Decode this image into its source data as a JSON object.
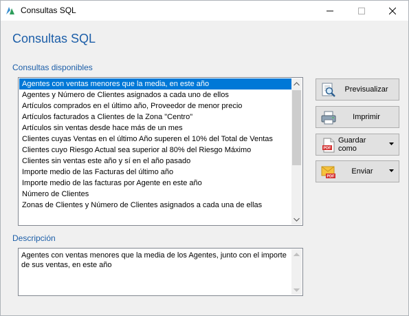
{
  "window": {
    "title": "Consultas SQL"
  },
  "heading": "Consultas SQL",
  "available": {
    "label": "Consultas disponibles",
    "selected_index": 0,
    "items": [
      "Agentes con ventas menores que la media, en este año",
      "Agentes y Número de Clientes asignados a cada uno de ellos",
      "Artículos comprados en el último año, Proveedor de menor precio",
      "Artículos facturados a Clientes de la Zona \"Centro\"",
      "Artículos sin ventas desde hace más de un mes",
      "Clientes cuyas Ventas en el último Año superen el 10% del Total de Ventas",
      "Clientes cuyo Riesgo Actual sea superior al 80% del Riesgo Máximo",
      "Clientes sin ventas este año y sí en el año pasado",
      "Importe medio de las Facturas del último año",
      "Importe medio de las facturas por Agente en este año",
      "Número de Clientes",
      "Zonas de Clientes y Número de Clientes asignados a cada una de ellas"
    ]
  },
  "description": {
    "label": "Descripción",
    "text": "Agentes con ventas menores que la media de los Agentes, junto con el importe de sus ventas, en este año"
  },
  "buttons": {
    "preview": "Previsualizar",
    "print": "Imprimir",
    "save_as": "Guardar como",
    "send": "Enviar"
  },
  "colors": {
    "accent": "#1c5ea8",
    "selection": "#0078d7"
  },
  "icons": {
    "app": "app-logo-icon",
    "preview": "magnifier-document-icon",
    "print": "printer-icon",
    "save_as": "pdf-document-icon",
    "send": "envelope-pdf-icon"
  }
}
